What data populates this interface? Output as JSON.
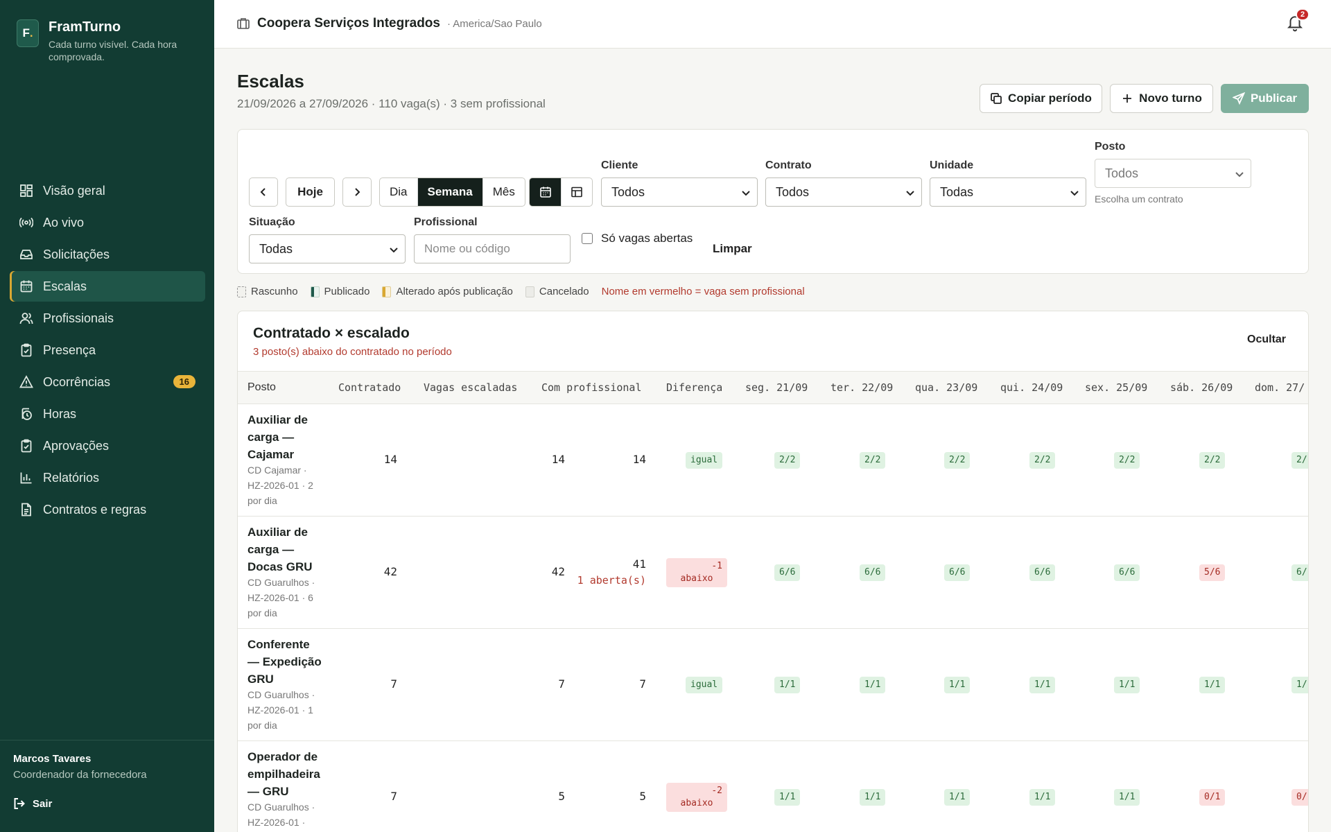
{
  "app": {
    "name": "FramTurno",
    "tagline": "Cada turno visível. Cada hora comprovada."
  },
  "sidebar": {
    "items": [
      {
        "label": "Visão geral",
        "icon": "grid-icon"
      },
      {
        "label": "Ao vivo",
        "icon": "broadcast-icon"
      },
      {
        "label": "Solicitações",
        "icon": "inbox-icon"
      },
      {
        "label": "Escalas",
        "icon": "calendar-icon",
        "active": true
      },
      {
        "label": "Profissionais",
        "icon": "users-icon"
      },
      {
        "label": "Presença",
        "icon": "clipboard-check-icon"
      },
      {
        "label": "Ocorrências",
        "icon": "warning-icon",
        "badge": "16"
      },
      {
        "label": "Horas",
        "icon": "clock-icon"
      },
      {
        "label": "Aprovações",
        "icon": "clipboard-check-icon"
      },
      {
        "label": "Relatórios",
        "icon": "bar-chart-icon"
      },
      {
        "label": "Contratos e regras",
        "icon": "document-icon"
      }
    ],
    "user": {
      "name": "Marcos Tavares",
      "role": "Coordenador da fornecedora"
    },
    "logout_label": "Sair"
  },
  "topbar": {
    "org_name": "Coopera Serviços Integrados",
    "timezone": "· America/Sao Paulo",
    "notifications": "2"
  },
  "page": {
    "title": "Escalas",
    "subtitle": "21/09/2026 a 27/09/2026 · 110 vaga(s) · 3 sem profissional",
    "actions": {
      "copy": "Copiar período",
      "new": "Novo turno",
      "publish": "Publicar"
    }
  },
  "filters": {
    "today": "Hoje",
    "views": [
      "Dia",
      "Semana",
      "Mês"
    ],
    "cliente": {
      "label": "Cliente",
      "value": "Todos"
    },
    "contrato": {
      "label": "Contrato",
      "value": "Todos"
    },
    "unidade": {
      "label": "Unidade",
      "value": "Todas"
    },
    "posto": {
      "label": "Posto",
      "value": "Todos",
      "hint": "Escolha um contrato"
    },
    "situacao": {
      "label": "Situação",
      "value": "Todas"
    },
    "profissional": {
      "label": "Profissional",
      "placeholder": "Nome ou código"
    },
    "only_open": "Só vagas abertas",
    "clear": "Limpar"
  },
  "legend": [
    {
      "label": "Rascunho",
      "color": "#e8e8e2"
    },
    {
      "label": "Publicado",
      "color": "#1f5a4b"
    },
    {
      "label": "Alterado após publicação",
      "color": "#d9a832"
    },
    {
      "label": "Cancelado",
      "color": "#d7d7d1"
    }
  ],
  "legend_note": "Nome em vermelho = vaga sem profissional",
  "table": {
    "title": "Contratado × escalado",
    "subtitle": "3 posto(s) abaixo do contratado no período",
    "hide_label": "Ocultar",
    "columns": [
      "Posto",
      "Contratado",
      "Vagas escaladas",
      "Com profissional",
      "Diferença",
      "seg. 21/09",
      "ter. 22/09",
      "qua. 23/09",
      "qui. 24/09",
      "sex. 25/09",
      "sáb. 26/09",
      "dom. 27/"
    ],
    "rows": [
      {
        "name": "Auxiliar de carga — Cajamar",
        "meta": "CD Cajamar · HZ-2026-01 · 2 por dia",
        "contracted": "14",
        "scheduled": "14",
        "staffed": "14",
        "open": "",
        "diff": "igual",
        "diff2": "",
        "diff_ok": true,
        "days": [
          {
            "v": "2/2",
            "ok": true
          },
          {
            "v": "2/2",
            "ok": true
          },
          {
            "v": "2/2",
            "ok": true
          },
          {
            "v": "2/2",
            "ok": true
          },
          {
            "v": "2/2",
            "ok": true
          },
          {
            "v": "2/2",
            "ok": true
          },
          {
            "v": "2/",
            "ok": true
          }
        ]
      },
      {
        "name": "Auxiliar de carga — Docas GRU",
        "meta": "CD Guarulhos · HZ-2026-01 · 6 por dia",
        "contracted": "42",
        "scheduled": "42",
        "staffed": "41",
        "open": "1 aberta(s)",
        "diff": "-1",
        "diff2": "abaixo",
        "diff_ok": false,
        "days": [
          {
            "v": "6/6",
            "ok": true
          },
          {
            "v": "6/6",
            "ok": true
          },
          {
            "v": "6/6",
            "ok": true
          },
          {
            "v": "6/6",
            "ok": true
          },
          {
            "v": "6/6",
            "ok": true
          },
          {
            "v": "5/6",
            "ok": false
          },
          {
            "v": "6/",
            "ok": true
          }
        ]
      },
      {
        "name": "Conferente — Expedição GRU",
        "meta": "CD Guarulhos · HZ-2026-01 · 1 por dia",
        "contracted": "7",
        "scheduled": "7",
        "staffed": "7",
        "open": "",
        "diff": "igual",
        "diff2": "",
        "diff_ok": true,
        "days": [
          {
            "v": "1/1",
            "ok": true
          },
          {
            "v": "1/1",
            "ok": true
          },
          {
            "v": "1/1",
            "ok": true
          },
          {
            "v": "1/1",
            "ok": true
          },
          {
            "v": "1/1",
            "ok": true
          },
          {
            "v": "1/1",
            "ok": true
          },
          {
            "v": "1/",
            "ok": true
          }
        ]
      },
      {
        "name": "Operador de empilhadeira — GRU",
        "meta": "CD Guarulhos · HZ-2026-01 ·",
        "contracted": "7",
        "scheduled": "5",
        "staffed": "5",
        "open": "",
        "diff": "-2",
        "diff2": "abaixo",
        "diff_ok": false,
        "days": [
          {
            "v": "1/1",
            "ok": true
          },
          {
            "v": "1/1",
            "ok": true
          },
          {
            "v": "1/1",
            "ok": true
          },
          {
            "v": "1/1",
            "ok": true
          },
          {
            "v": "1/1",
            "ok": true
          },
          {
            "v": "0/1",
            "ok": false
          },
          {
            "v": "0/",
            "ok": false
          }
        ]
      }
    ]
  }
}
